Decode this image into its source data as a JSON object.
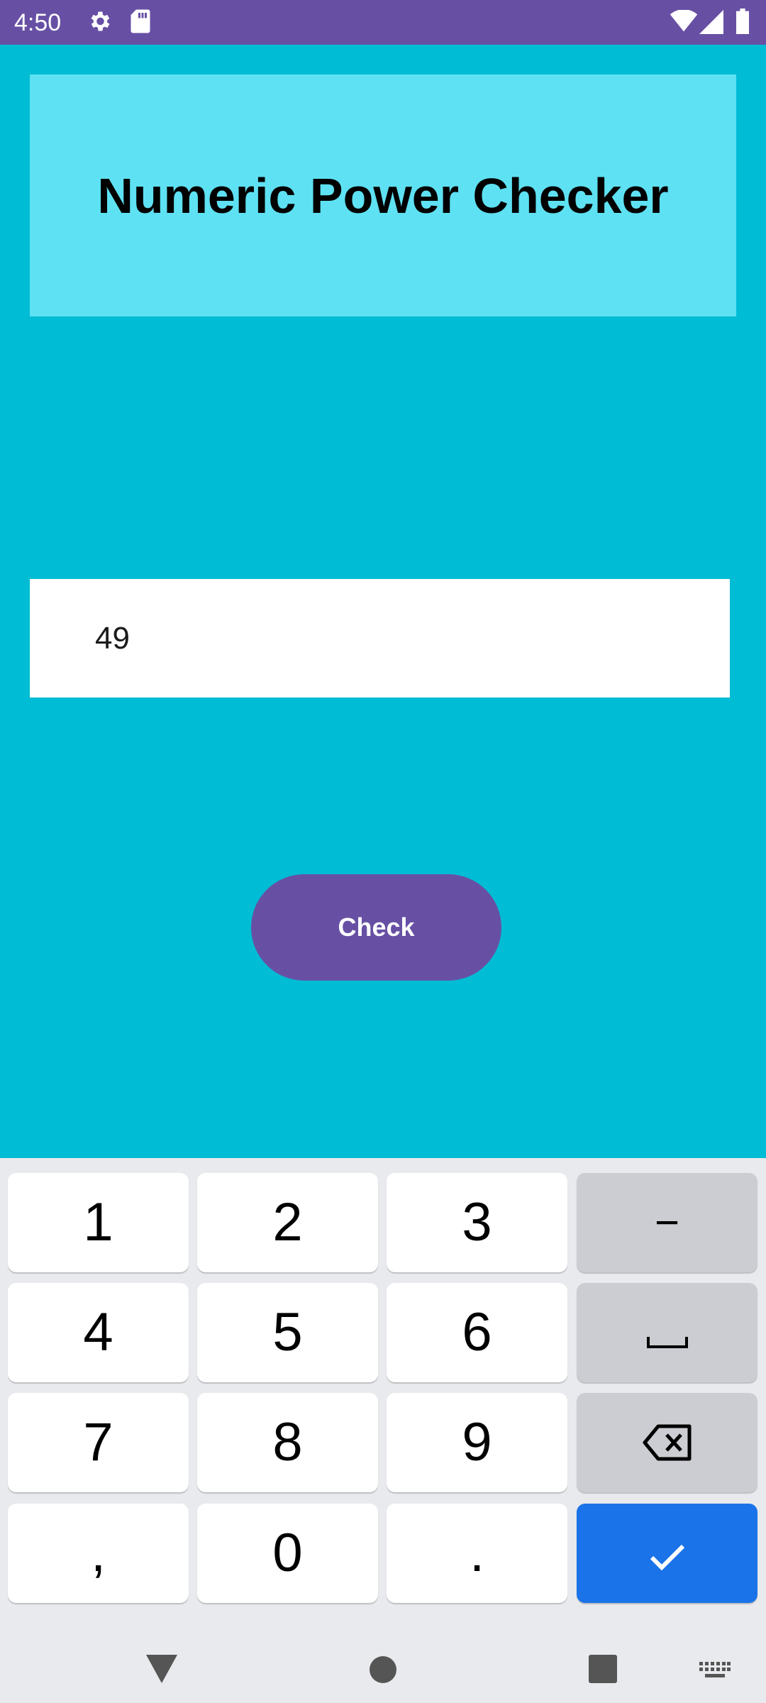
{
  "status_bar": {
    "time": "4:50",
    "icons": [
      "gear-icon",
      "sd-card-icon",
      "wifi-icon",
      "signal-icon",
      "battery-icon"
    ]
  },
  "app": {
    "title": "Numeric Power Checker",
    "input": {
      "value": "49",
      "placeholder": ""
    },
    "check_label": "Check"
  },
  "keyboard": {
    "rows": [
      [
        "1",
        "2",
        "3",
        "−"
      ],
      [
        "4",
        "5",
        "6",
        "space"
      ],
      [
        "7",
        "8",
        "9",
        "backspace"
      ],
      [
        ",",
        "0",
        ".",
        "enter"
      ]
    ],
    "k1": "1",
    "k2": "2",
    "k3": "3",
    "kminus": "−",
    "k4": "4",
    "k5": "5",
    "k6": "6",
    "k7": "7",
    "k8": "8",
    "k9": "9",
    "kcomma": ",",
    "k0": "0",
    "kdot": "."
  },
  "nav_bar": {
    "items": [
      "back-icon",
      "home-icon",
      "recents-icon",
      "keyboard-switch-icon"
    ]
  },
  "colors": {
    "status_bar": "#6750A4",
    "background": "#00BCD4",
    "title_card": "#5EE1F2",
    "button": "#6750A4",
    "enter_key": "#1A73E8",
    "keyboard_bg": "#E8EAED"
  }
}
